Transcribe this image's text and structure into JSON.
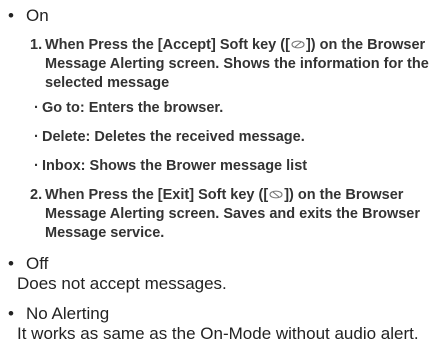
{
  "on": {
    "label": "On",
    "item1": {
      "num": "1.",
      "before": "When Press the [Accept] Soft key ([",
      "after": "]) on the Browser Message Alerting screen. Shows the information for the selected message"
    },
    "options": [
      {
        "label": "Go to: Enters the browser."
      },
      {
        "label": "Delete: Deletes the received message."
      },
      {
        "label": "Inbox: Shows the Brower message list"
      }
    ],
    "item2": {
      "num": "2.",
      "before": "When Press the [Exit] Soft key ([",
      "after": "]) on the Browser Message Alerting screen. Saves and exits the Browser Message service."
    }
  },
  "off": {
    "label": "Off",
    "desc": "Does not accept messages."
  },
  "no_alerting": {
    "label": "No Alerting",
    "desc": "It works as same as the On-Mode without audio alert."
  },
  "icons": {
    "accept_key": "left-softkey-icon",
    "exit_key": "right-softkey-icon"
  }
}
